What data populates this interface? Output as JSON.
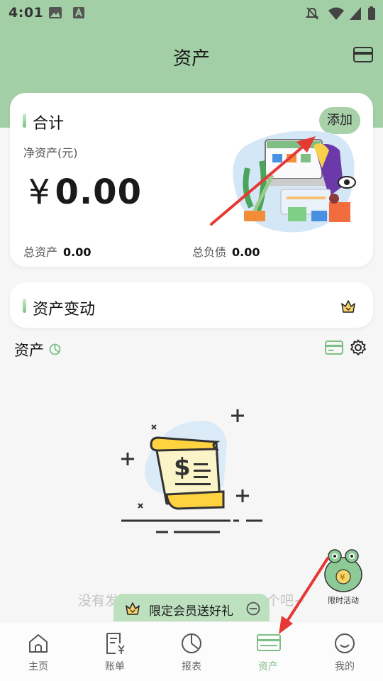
{
  "status_bar": {
    "time": "4:01"
  },
  "header": {
    "title": "资产"
  },
  "summary_card": {
    "title": "合计",
    "add_label": "添加",
    "net_label": "净资产(元)",
    "currency": "¥",
    "net_value": "0.00",
    "total_assets_label": "总资产",
    "total_assets_value": "0.00",
    "total_liabilities_label": "总负债",
    "total_liabilities_value": "0.00"
  },
  "changes_card": {
    "title": "资产变动"
  },
  "assets_section": {
    "title": "资产"
  },
  "empty_state": {
    "text": "没有发现资产账户，试着添加一个吧~"
  },
  "promo": {
    "label": "限定会员送好礼"
  },
  "mascot": {
    "label": "限时活动"
  },
  "tabs": [
    {
      "label": "主页"
    },
    {
      "label": "账单"
    },
    {
      "label": "报表"
    },
    {
      "label": "资产"
    },
    {
      "label": "我的"
    }
  ],
  "colors": {
    "accent": "#a3cfa6",
    "active_tab": "#7fbf86",
    "arrow": "#e53935"
  }
}
